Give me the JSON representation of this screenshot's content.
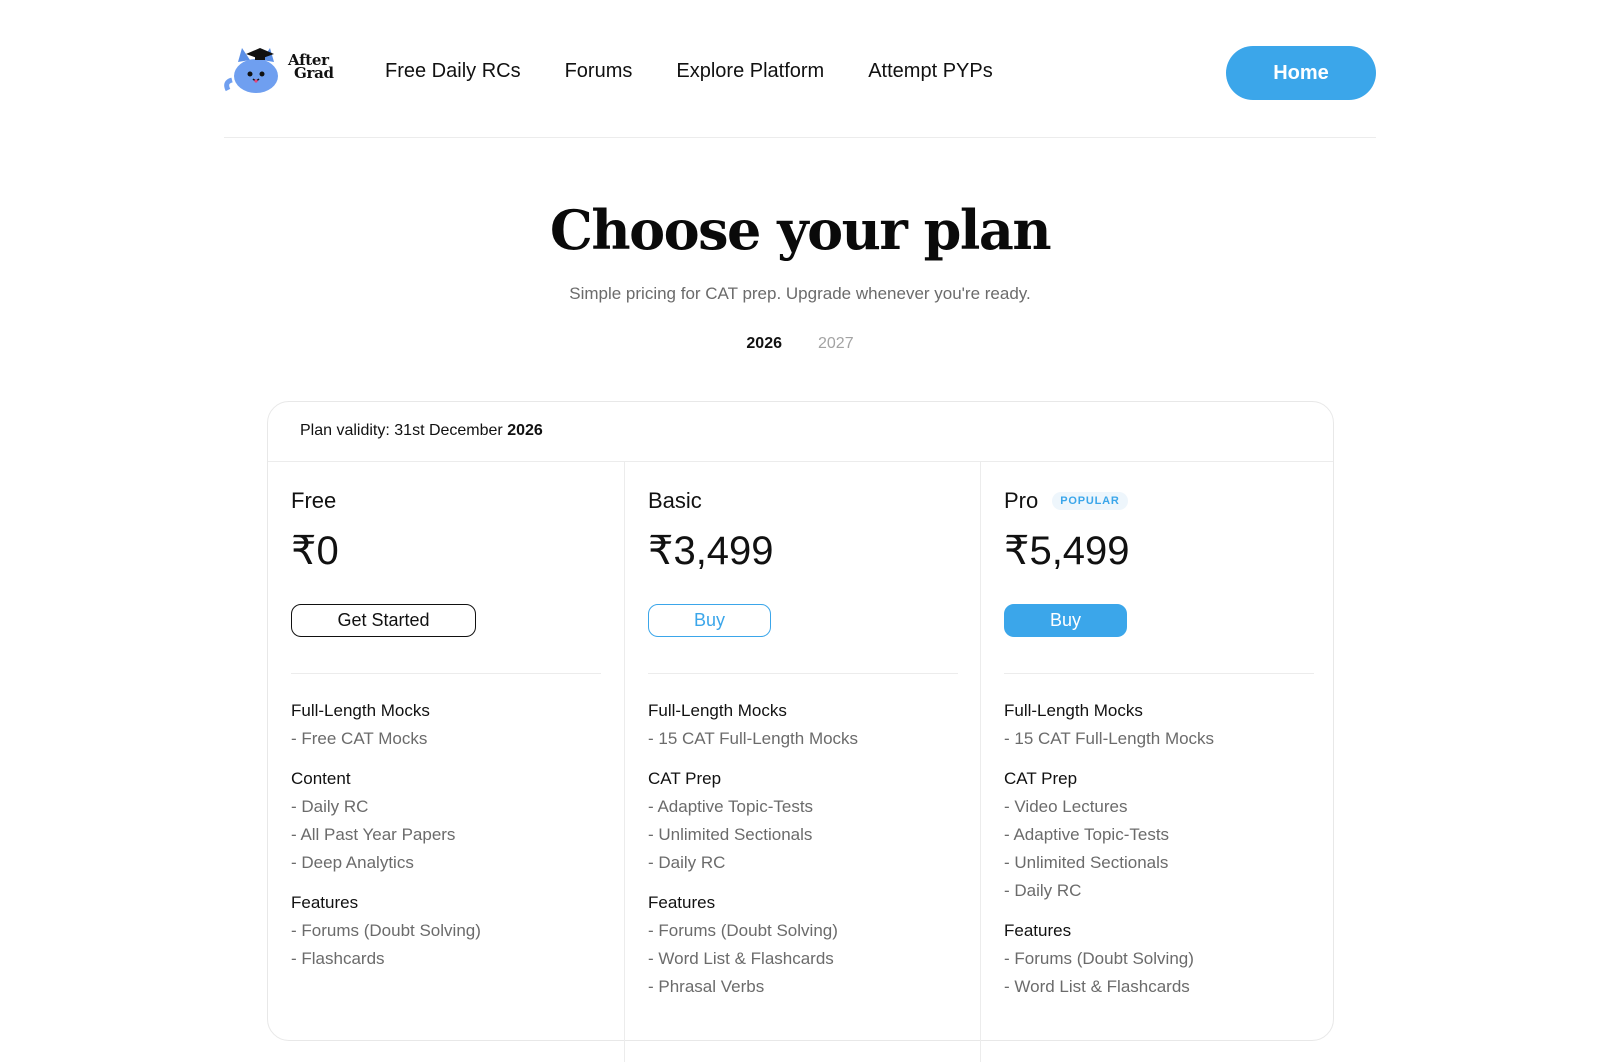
{
  "header": {
    "logo": {
      "line1": "After",
      "line2": "Grad"
    },
    "nav": [
      "Free Daily RCs",
      "Forums",
      "Explore Platform",
      "Attempt PYPs"
    ],
    "home_label": "Home"
  },
  "hero": {
    "title": "Choose your plan",
    "subtitle": "Simple pricing for CAT prep. Upgrade whenever you're ready.",
    "years": [
      "2026",
      "2027"
    ],
    "active_year": "2026"
  },
  "card": {
    "validity_prefix": "Plan validity: 31st December ",
    "validity_year": "2026"
  },
  "plans": [
    {
      "name": "Free",
      "price": "₹0",
      "button": "Get Started",
      "groups": [
        {
          "title": "Full-Length Mocks",
          "items": [
            "- Free CAT Mocks"
          ]
        },
        {
          "title": "Content",
          "items": [
            "- Daily RC",
            "- All Past Year Papers",
            "- Deep Analytics"
          ]
        },
        {
          "title": "Features",
          "items": [
            "- Forums (Doubt Solving)",
            "- Flashcards"
          ]
        }
      ]
    },
    {
      "name": "Basic",
      "price": "₹3,499",
      "button": "Buy",
      "groups": [
        {
          "title": "Full-Length Mocks",
          "items": [
            "- 15 CAT Full-Length Mocks"
          ]
        },
        {
          "title": "CAT Prep",
          "items": [
            "- Adaptive Topic-Tests",
            "- Unlimited Sectionals",
            "- Daily RC"
          ]
        },
        {
          "title": "Features",
          "items": [
            "- Forums (Doubt Solving)",
            "- Word List & Flashcards",
            "- Phrasal Verbs"
          ]
        }
      ]
    },
    {
      "name": "Pro",
      "badge": "POPULAR",
      "price": "₹5,499",
      "button": "Buy",
      "groups": [
        {
          "title": "Full-Length Mocks",
          "items": [
            "- 15 CAT Full-Length Mocks"
          ]
        },
        {
          "title": "CAT Prep",
          "items": [
            "- Video Lectures",
            "- Adaptive Topic-Tests",
            "- Unlimited Sectionals",
            "- Daily RC"
          ]
        },
        {
          "title": "Features",
          "items": [
            "- Forums (Doubt Solving)",
            "- Word List & Flashcards"
          ]
        }
      ]
    }
  ],
  "colors": {
    "accent": "#3ba6ea",
    "text": "#111111",
    "muted": "#6b6b6b"
  }
}
